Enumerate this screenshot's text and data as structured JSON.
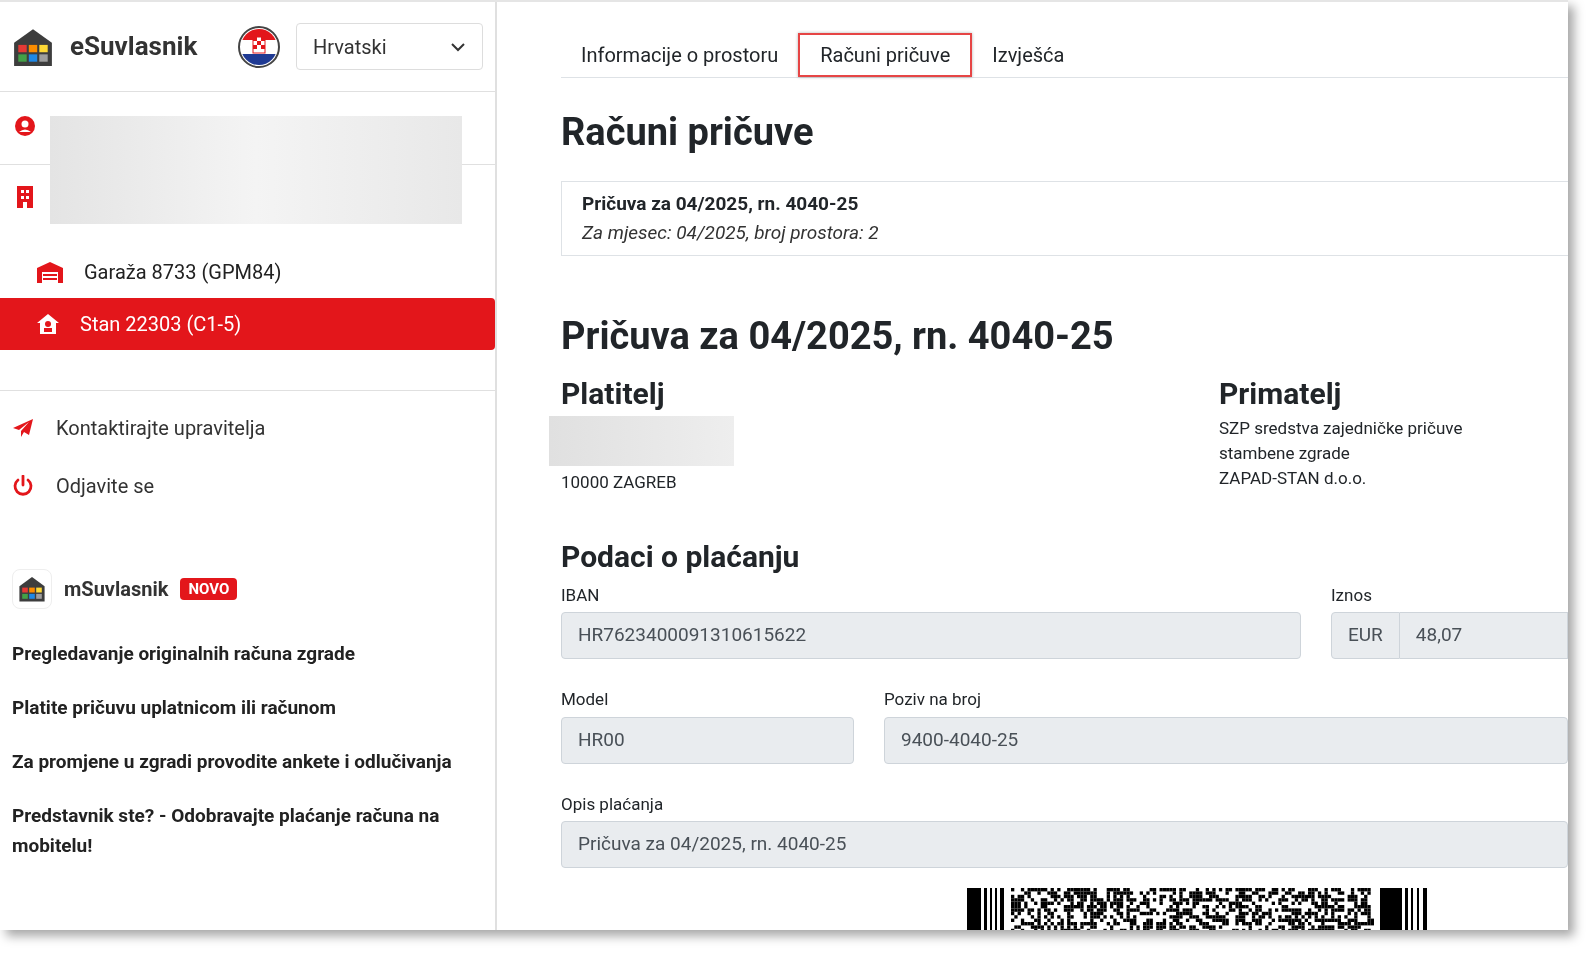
{
  "sidebar": {
    "brand": "eSuvlasnik",
    "language": {
      "value": "Hrvatski"
    },
    "units": [
      {
        "label": "Garaža 8733 (GPM84)",
        "kind": "garage",
        "selected": false
      },
      {
        "label": "Stan 22303 (C1-5)",
        "kind": "apartment",
        "selected": true
      }
    ],
    "actions": [
      {
        "label": "Kontaktirajte upravitelja",
        "kind": "contact"
      },
      {
        "label": "Odjavite se",
        "kind": "logout"
      }
    ],
    "app": {
      "name": "mSuvlasnik",
      "badge": "NOVO"
    },
    "features": [
      "Pregledavanje originalnih računa zgrade",
      "Platite pričuvu uplatnicom ili računom",
      "Za promjene u zgradi provodite ankete i odlučivanja",
      "Predstavnik ste? - Odobravajte plaćanje računa na mobitelu!"
    ]
  },
  "tabs": [
    {
      "label": "Informacije o prostoru",
      "selected": false
    },
    {
      "label": "Računi pričuve",
      "selected": true
    },
    {
      "label": "Izvješća",
      "selected": false
    }
  ],
  "title": "Računi pričuve",
  "bill_card": {
    "title": "Pričuva za 04/2025, rn. 4040-25",
    "subtitle": "Za mjesec: 04/2025, broj prostora: 2"
  },
  "bill": {
    "heading": "Pričuva za 04/2025, rn. 4040-25",
    "payer": {
      "label": "Platitelj",
      "city": "10000 ZAGREB"
    },
    "payee": {
      "label": "Primatelj",
      "lines": [
        "SZP sredstva zajedničke pričuve",
        "stambene zgrade",
        "ZAPAD-STAN d.o.o."
      ]
    },
    "payment": {
      "heading": "Podaci o plaćanju",
      "iban": {
        "label": "IBAN",
        "value": "HR7623400091310615622"
      },
      "amount": {
        "label": "Iznos",
        "currency": "EUR",
        "value": "48,07"
      },
      "model": {
        "label": "Model",
        "value": "HR00"
      },
      "reference": {
        "label": "Poziv na broj",
        "value": "9400-4040-25"
      },
      "description": {
        "label": "Opis plaćanja",
        "value": "Pričuva za 04/2025, rn. 4040-25"
      }
    }
  }
}
